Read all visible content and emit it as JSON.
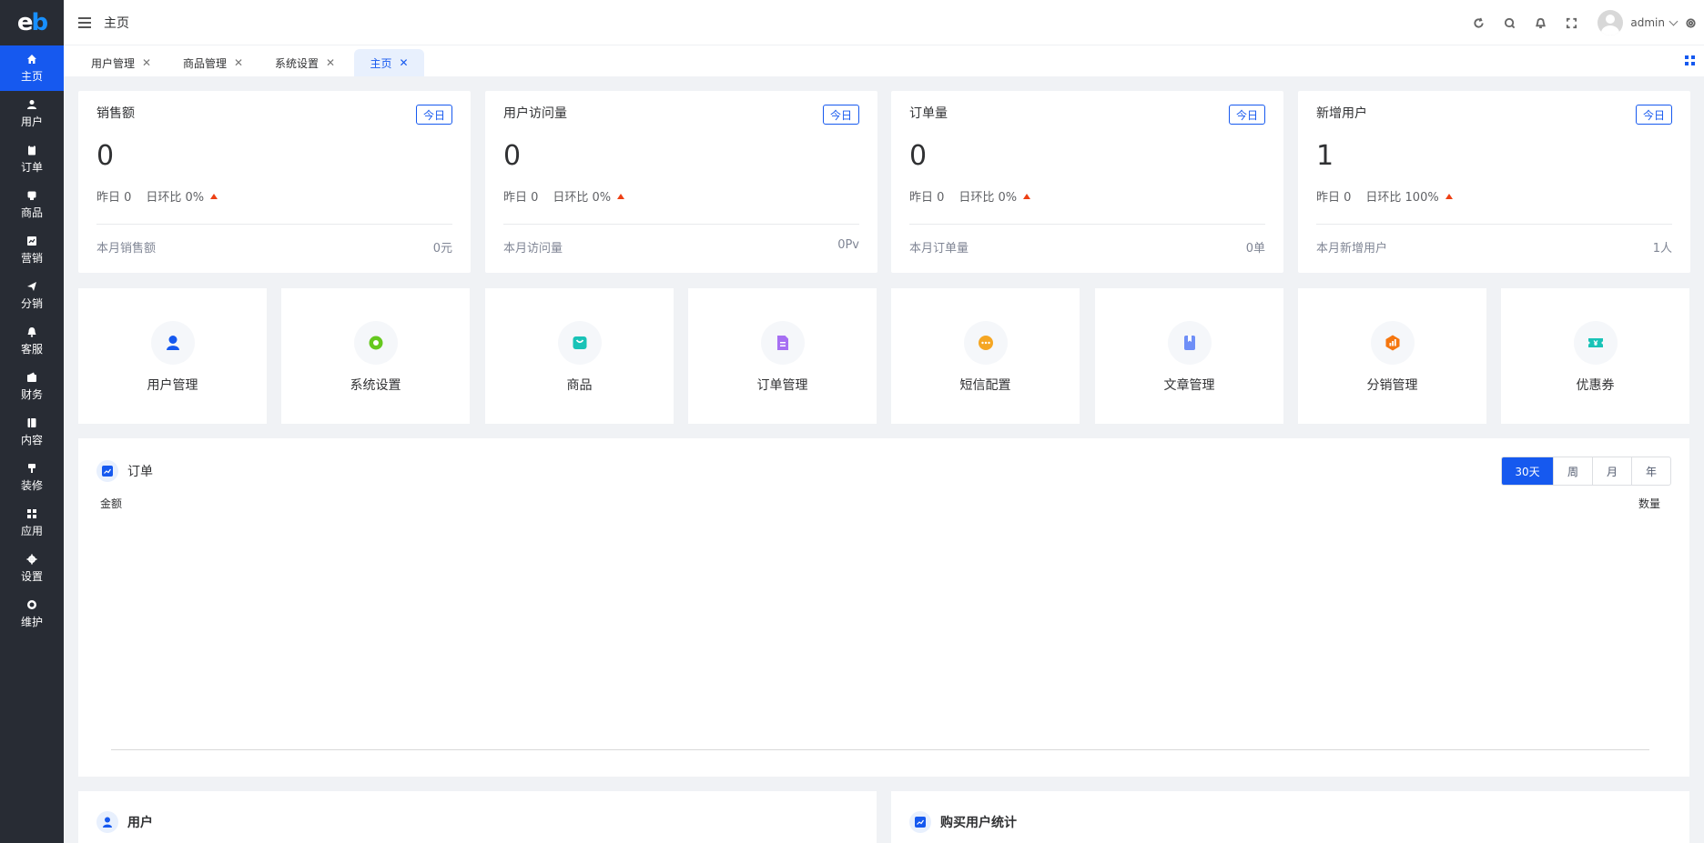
{
  "app": {
    "logo_text": "eb"
  },
  "sidebar": {
    "items": [
      {
        "label": "主页",
        "icon": "home-icon"
      },
      {
        "label": "用户",
        "icon": "user-icon"
      },
      {
        "label": "订单",
        "icon": "clipboard-icon"
      },
      {
        "label": "商品",
        "icon": "product-icon"
      },
      {
        "label": "营销",
        "icon": "chart-icon"
      },
      {
        "label": "分销",
        "icon": "send-icon"
      },
      {
        "label": "客服",
        "icon": "bell-icon"
      },
      {
        "label": "财务",
        "icon": "wallet-icon"
      },
      {
        "label": "内容",
        "icon": "book-icon"
      },
      {
        "label": "装修",
        "icon": "brush-icon"
      },
      {
        "label": "应用",
        "icon": "apps-icon"
      },
      {
        "label": "设置",
        "icon": "gear-icon"
      },
      {
        "label": "维护",
        "icon": "maintenance-icon"
      }
    ]
  },
  "header": {
    "breadcrumb": "主页",
    "user_name": "admin"
  },
  "tabs": [
    {
      "label": "用户管理",
      "active": false
    },
    {
      "label": "商品管理",
      "active": false
    },
    {
      "label": "系统设置",
      "active": false
    },
    {
      "label": "主页",
      "active": true
    }
  ],
  "stats": [
    {
      "title": "销售额",
      "tag": "今日",
      "value": "0",
      "yesterday": "昨日 0",
      "ratio": "日环比 0%",
      "foot_label": "本月销售额",
      "foot_value": "0元"
    },
    {
      "title": "用户访问量",
      "tag": "今日",
      "value": "0",
      "yesterday": "昨日 0",
      "ratio": "日环比 0%",
      "foot_label": "本月访问量",
      "foot_value": "0Pv"
    },
    {
      "title": "订单量",
      "tag": "今日",
      "value": "0",
      "yesterday": "昨日 0",
      "ratio": "日环比 0%",
      "foot_label": "本月订单量",
      "foot_value": "0单"
    },
    {
      "title": "新增用户",
      "tag": "今日",
      "value": "1",
      "yesterday": "昨日 0",
      "ratio": "日环比 100%",
      "foot_label": "本月新增用户",
      "foot_value": "1人"
    }
  ],
  "quick_entries": [
    {
      "label": "用户管理",
      "icon": "user-icon",
      "color": "#1659ef"
    },
    {
      "label": "系统设置",
      "icon": "gear-icon",
      "color": "#65c81e"
    },
    {
      "label": "商品",
      "icon": "bag-icon",
      "color": "#19c3b7"
    },
    {
      "label": "订单管理",
      "icon": "document-icon",
      "color": "#a66ff2"
    },
    {
      "label": "短信配置",
      "icon": "message-icon",
      "color": "#f5a623"
    },
    {
      "label": "文章管理",
      "icon": "bookmark-icon",
      "color": "#6f8ff7"
    },
    {
      "label": "分销管理",
      "icon": "distribution-icon",
      "color": "#f5760f"
    },
    {
      "label": "优惠券",
      "icon": "coupon-icon",
      "color": "#19c3b7"
    }
  ],
  "order_chart": {
    "title": "订单",
    "ranges": [
      "30天",
      "周",
      "月",
      "年"
    ],
    "selected_range": "30天",
    "left_axis": "金额",
    "right_axis": "数量"
  },
  "bottom": {
    "user_title": "用户",
    "purchase_title": "购买用户统计"
  },
  "colors": {
    "primary": "#1659ef",
    "sidebar_bg": "#282c34",
    "up_arrow": "#ed4014"
  }
}
